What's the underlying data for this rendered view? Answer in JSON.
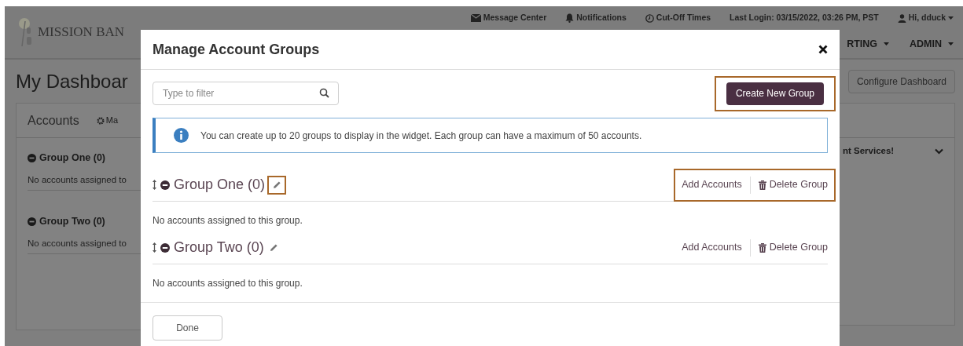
{
  "top_bar": {
    "links": [
      {
        "kind": "mail",
        "label": "Message Center"
      },
      {
        "kind": "bell",
        "label": "Notifications"
      },
      {
        "kind": "clock",
        "label": "Cut-Off Times"
      },
      {
        "kind": "text",
        "label": "Last Login: 03/15/2022, 03:26 PM, PST"
      },
      {
        "kind": "user",
        "label": "Hi, dduck"
      }
    ]
  },
  "logo": {
    "text": "MISSION BAN"
  },
  "nav": [
    {
      "label": "RTING"
    },
    {
      "label": "ADMIN"
    }
  ],
  "page_title": "My Dashboar",
  "configure_button": "Configure Dashboard",
  "accounts_panel": {
    "title": "Accounts",
    "manage_link": "Ma",
    "groups": [
      {
        "name": "Group One (0)",
        "empty_text": "No accounts assigned to"
      },
      {
        "name": "Group Two (0)",
        "empty_text": "No accounts assigned to"
      }
    ]
  },
  "right_panel": {
    "title": "nt Services!"
  },
  "modal": {
    "title": "Manage Account Groups",
    "filter": {
      "placeholder": "Type to filter"
    },
    "create_button": {
      "label": "Create New Group",
      "highlighted": true
    },
    "info": "You can create up to 20 groups to display in the widget. Each group can have a maximum of 50 accounts.",
    "groups": [
      {
        "name": "Group One (0)",
        "edit_highlighted": true,
        "add_label": "Add Accounts",
        "delete_label": "Delete Group",
        "actions_highlighted": true,
        "empty_text": "No accounts assigned to this group."
      },
      {
        "name": "Group Two (0)",
        "edit_highlighted": false,
        "add_label": "Add Accounts",
        "delete_label": "Delete Group",
        "actions_highlighted": false,
        "empty_text": "No accounts assigned to this group."
      }
    ],
    "done": "Done"
  }
}
